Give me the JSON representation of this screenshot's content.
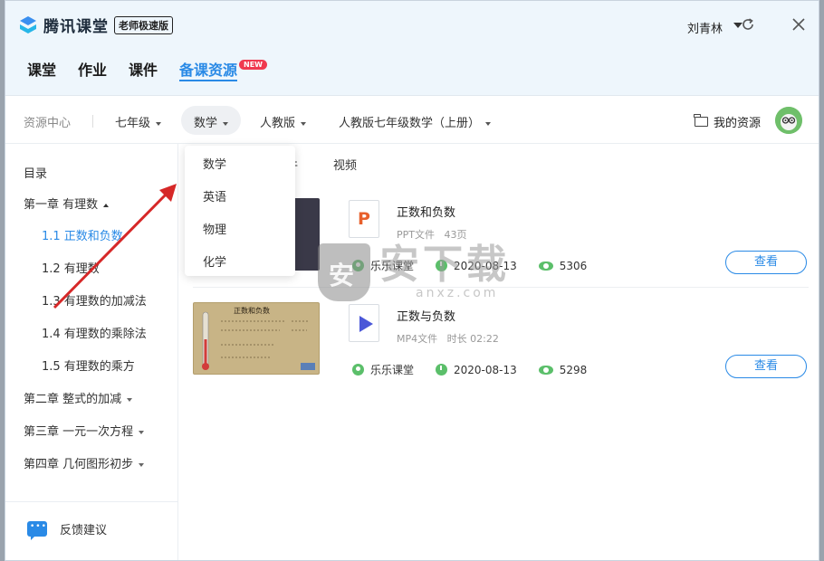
{
  "app": {
    "name": "腾讯课堂",
    "edition_badge": "老师极速版",
    "user_name": "刘青林"
  },
  "nav": {
    "tabs": [
      {
        "label": "课堂"
      },
      {
        "label": "作业"
      },
      {
        "label": "课件"
      },
      {
        "label": "备课资源",
        "active": true
      }
    ],
    "new_badge": "NEW"
  },
  "filters": {
    "resource_center": "资源中心",
    "grade": "七年级",
    "subject": "数学",
    "edition": "人教版",
    "textbook": "人教版七年级数学（上册）",
    "my_resources": "我的资源"
  },
  "subject_dropdown": {
    "options": [
      "数学",
      "英语",
      "物理",
      "化学"
    ]
  },
  "sidebar": {
    "title": "目录",
    "items": [
      {
        "label": "第一章 有理数",
        "level": 1,
        "expanded": true
      },
      {
        "label": "1.1 正数和负数",
        "level": 2,
        "active": true
      },
      {
        "label": "1.2 有理数",
        "level": 2
      },
      {
        "label": "1.3 有理数的加减法",
        "level": 2
      },
      {
        "label": "1.4 有理数的乘除法",
        "level": 2
      },
      {
        "label": "1.5 有理数的乘方",
        "level": 2
      },
      {
        "label": "第二章 整式的加减",
        "level": 1
      },
      {
        "label": "第三章 一元一次方程",
        "level": 1
      },
      {
        "label": "第四章 几何图形初步",
        "level": 1
      }
    ],
    "feedback": "反馈建议"
  },
  "content": {
    "tabs": [
      "件",
      "视频"
    ],
    "resources": [
      {
        "title": "正数和负数",
        "type": "PPT文件",
        "detail": "43页",
        "publisher": "乐乐课堂",
        "date": "2020-08-13",
        "views": "5306",
        "action": "查看",
        "icon": "ppt-file-icon"
      },
      {
        "title": "正数与负数",
        "type": "MP4文件",
        "detail": "时长 02:22",
        "publisher": "乐乐课堂",
        "date": "2020-08-13",
        "views": "5298",
        "action": "查看",
        "icon": "video-file-icon"
      }
    ],
    "board_thumbnail": {
      "title": "正数和负数"
    }
  },
  "watermark": {
    "big": "安下载",
    "small": "anxz.com"
  },
  "colors": {
    "accent": "#2a8ae6",
    "new_badge": "#f0394f",
    "stat_green": "#5bbf6a",
    "arrow": "#d62828"
  }
}
